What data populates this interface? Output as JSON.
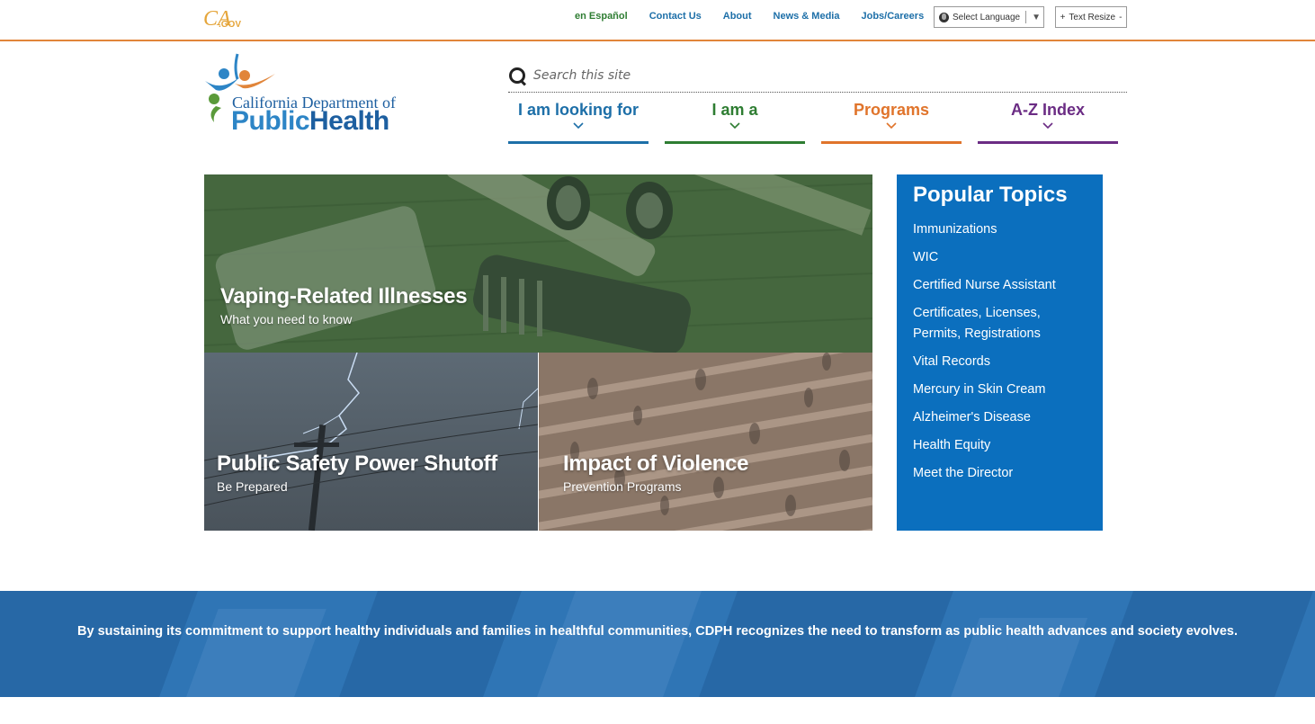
{
  "utility": {
    "cagov_logo_text": "CA.GOV",
    "links": [
      "en Español",
      "Contact Us",
      "About",
      "News & Media",
      "Jobs/Careers"
    ],
    "language_select": "Select Language",
    "text_resize": "Text Resize",
    "text_resize_plus": "+",
    "text_resize_minus": "-"
  },
  "header": {
    "logo_line1": "California Department of",
    "logo_public": "Public",
    "logo_health": "Health",
    "search_placeholder": "Search this site"
  },
  "nav": {
    "tabs": [
      {
        "label": "I am looking for",
        "color": "#1d6fa8"
      },
      {
        "label": "I am a",
        "color": "#2e7d32"
      },
      {
        "label": "Programs",
        "color": "#e0742b"
      },
      {
        "label": "A-Z Index",
        "color": "#6b2c84"
      }
    ]
  },
  "tiles": {
    "vaping": {
      "title": "Vaping-Related Illnesses",
      "subtitle": "What you need to know"
    },
    "psps": {
      "title": "Public Safety Power Shutoff",
      "subtitle": "Be Prepared"
    },
    "violence": {
      "title": "Impact of Violence",
      "subtitle": "Prevention Programs"
    }
  },
  "popular": {
    "heading": "Popular Topics",
    "items": [
      "Immunizations",
      "WIC",
      "Certified Nurse Assistant",
      "Certificates, Licenses, Permits, Registrations",
      "Vital Records",
      "Mercury in Skin Cream",
      "Alzheimer's Disease",
      "Health Equity",
      "Meet the Director"
    ]
  },
  "banner": {
    "text": "By sustaining its commitment to support healthy individuals and families in healthful communities, CDPH recognizes the need to transform as public health advances and society evolves."
  },
  "colors": {
    "accent_orange": "#e1853a",
    "popular_blue": "#0b6fbe",
    "banner_blue": "#2f75b5"
  }
}
